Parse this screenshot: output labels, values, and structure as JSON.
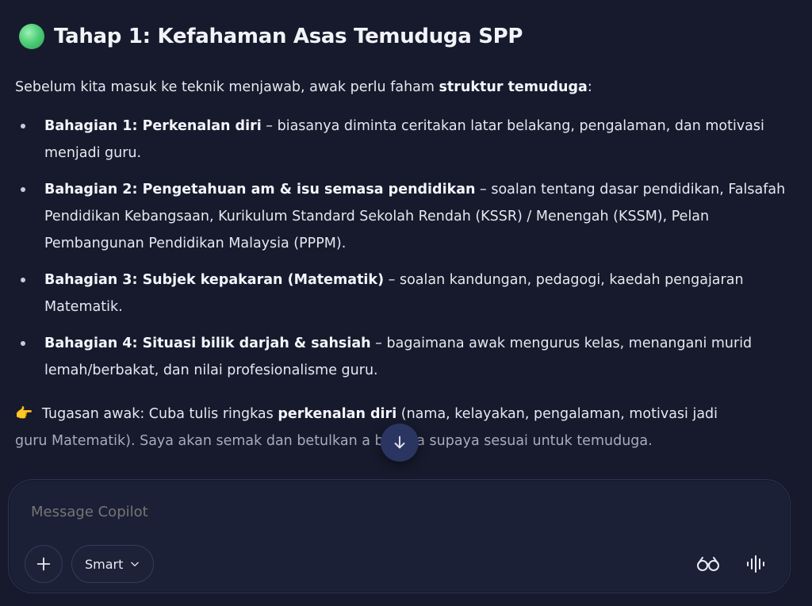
{
  "header": {
    "title": "Tahap 1: Kefahaman Asas Temuduga SPP"
  },
  "intro": {
    "before": "Sebelum kita masuk ke teknik menjawab, awak perlu faham ",
    "bold": "struktur temuduga",
    "after": ":"
  },
  "sections": [
    {
      "bold": "Bahagian 1: Perkenalan diri",
      "text": " – biasanya diminta ceritakan latar belakang, pengalaman, dan motivasi menjadi guru."
    },
    {
      "bold": "Bahagian 2: Pengetahuan am & isu semasa pendidikan",
      "text": " – soalan tentang dasar pendidikan, Falsafah Pendidikan Kebangsaan, Kurikulum Standard Sekolah Rendah (KSSR) / Menengah (KSSM), Pelan Pembangunan Pendidikan Malaysia (PPPM)."
    },
    {
      "bold": "Bahagian 3: Subjek kepakaran (Matematik)",
      "text": " – soalan kandungan, pedagogi, kaedah pengajaran Matematik."
    },
    {
      "bold": "Bahagian 4: Situasi bilik darjah & sahsiah",
      "text": " – bagaimana awak mengurus kelas, menangani murid lemah/berbakat, dan nilai profesionalisme guru."
    }
  ],
  "task": {
    "icon": "👉",
    "before": " Tugasan awak: Cuba tulis ringkas ",
    "bold": "perkenalan diri",
    "after": " (nama, kelayakan, pengalaman, motivasi jadi",
    "line2": "guru Matematik). Saya akan semak dan betulkan    a bahasa supaya sesuai untuk temuduga."
  },
  "composer": {
    "placeholder": "Message Copilot",
    "mode_label": "Smart"
  },
  "icons": {
    "title": "green-circle-icon",
    "scroll": "arrow-down-icon",
    "plus": "plus-icon",
    "chevron": "chevron-down-icon",
    "glasses": "glasses-icon",
    "voice": "voice-waveform-icon"
  }
}
